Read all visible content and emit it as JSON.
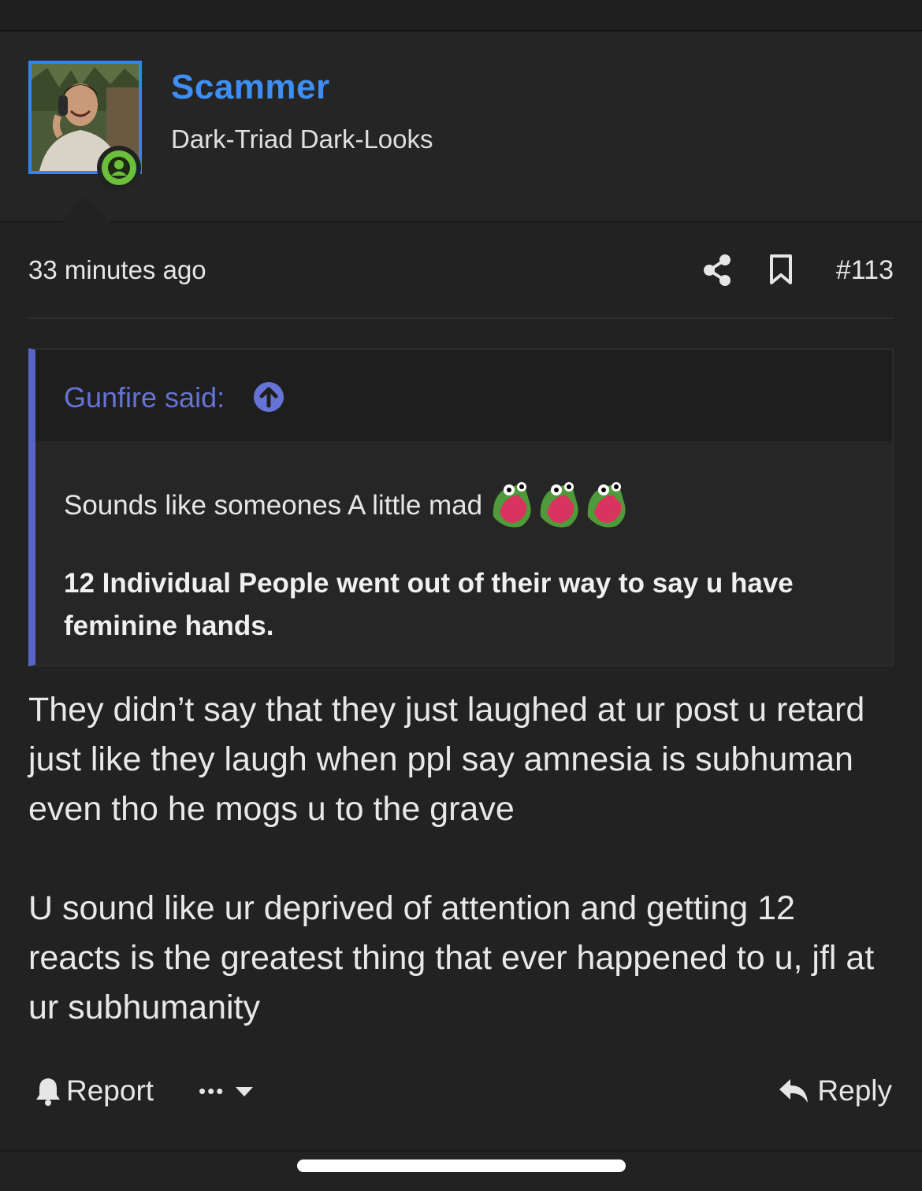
{
  "user": {
    "name": "Scammer",
    "title": "Dark-Triad Dark-Looks",
    "name_color": "#3d8ff5",
    "status_color": "#6cbf3a"
  },
  "meta": {
    "timestamp": "33 minutes ago",
    "post_number": "#113",
    "share_icon": "share-icon",
    "bookmark_icon": "bookmark-icon"
  },
  "quote": {
    "author": "Gunfire said:",
    "line1": "Sounds like someones A little mad",
    "emoji_count": 3,
    "emoji_name": "frog-laugh-emoji",
    "bold_text": "12 Individual People went out of their way to say u have feminine hands.",
    "accent_color": "#5865c6"
  },
  "post": {
    "paragraphs": [
      "They didn’t say that they just laughed at ur post u retard just like they laugh when ppl say amnesia is subhuman even tho he mogs u to the grave",
      "U sound like ur deprived of attention and getting 12 reacts is the greatest thing that ever happened to u, jfl at ur subhumanity"
    ]
  },
  "actions": {
    "report_label": "Report",
    "more_label": "•••",
    "reply_label": "Reply"
  }
}
